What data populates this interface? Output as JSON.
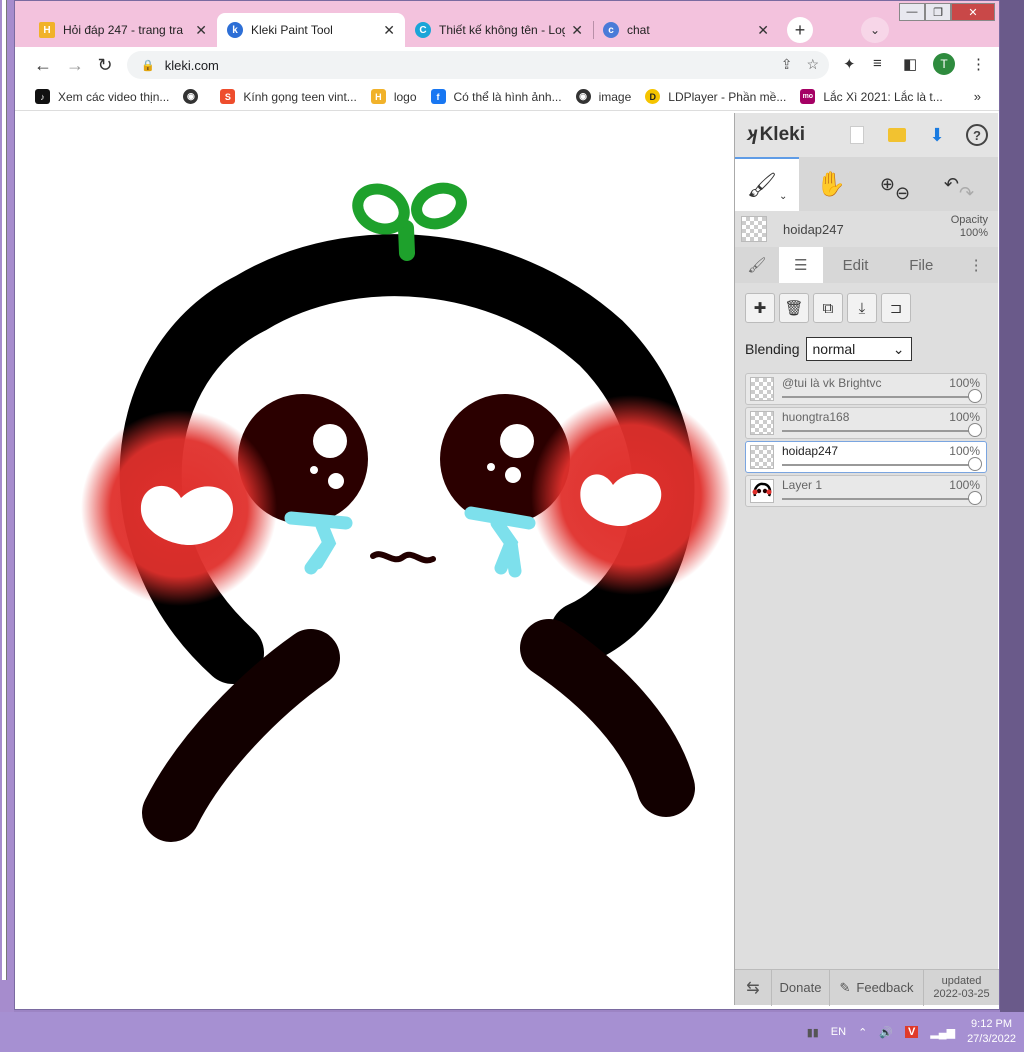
{
  "browser": {
    "tabs": [
      {
        "title": "Hỏi đáp 247 - trang tra",
        "icon": "hoidap-favicon-icon",
        "color": "#f1b22a"
      },
      {
        "title": "Kleki Paint Tool",
        "icon": "kleki-favicon-icon",
        "color": "#2d6fd6"
      },
      {
        "title": "Thiết kế không tên - Log",
        "icon": "canva-favicon-icon",
        "color": "#1aa5d8"
      },
      {
        "title": "chat",
        "icon": "chat-favicon-icon",
        "color": "#4a7bd8"
      }
    ],
    "new_tab": "+",
    "url": "kleki.com",
    "profile_initial": "T",
    "bookmarks": [
      {
        "label": "Xem các video thịn...",
        "icon": "tiktok-icon",
        "color": "#111111"
      },
      {
        "label": "",
        "icon": "globe-icon",
        "color": "#333333"
      },
      {
        "label": "Kính gọng teen vint...",
        "icon": "shopee-icon",
        "color": "#ee4d2d"
      },
      {
        "label": "logo",
        "icon": "hoidap-icon",
        "color": "#f1b22a"
      },
      {
        "label": "Có thể là hình ảnh...",
        "icon": "facebook-icon",
        "color": "#1877f2"
      },
      {
        "label": "image",
        "icon": "globe-icon",
        "color": "#333333"
      },
      {
        "label": "LDPlayer - Phần mề...",
        "icon": "ldplayer-icon",
        "color": "#f5c400"
      },
      {
        "label": "Lắc Xì 2021: Lắc là t...",
        "icon": "momo-icon",
        "color": "#a50064"
      }
    ],
    "bookmarks_more": "»"
  },
  "kleki": {
    "brand": "Kleki",
    "current_layer": {
      "name": "hoidap247",
      "opacity_label": "Opacity",
      "opacity_value": "100%"
    },
    "tabs": {
      "edit": "Edit",
      "file": "File"
    },
    "blending_label": "Blending",
    "blending_value": "normal",
    "layers": [
      {
        "name": "@tui là vk Brightvc",
        "opacity": "100%",
        "active": false
      },
      {
        "name": "huongtra168",
        "opacity": "100%",
        "active": false
      },
      {
        "name": "hoidap247",
        "opacity": "100%",
        "active": true
      },
      {
        "name": "Layer 1",
        "opacity": "100%",
        "active": false
      }
    ],
    "footer": {
      "donate": "Donate",
      "feedback": "Feedback",
      "updated_label": "updated",
      "updated_date": "2022-03-25"
    }
  },
  "taskbar": {
    "lang": "EN",
    "time": "9:12 PM",
    "date": "27/3/2022"
  }
}
